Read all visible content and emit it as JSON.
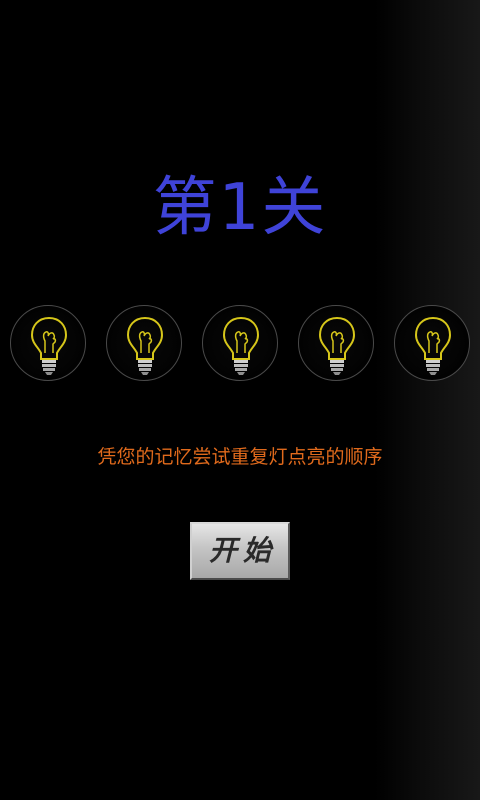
{
  "level": {
    "title": "第1关"
  },
  "bulbs": [
    {
      "state": "off",
      "glow_color": "#d6c61a"
    },
    {
      "state": "off",
      "glow_color": "#d6c61a"
    },
    {
      "state": "off",
      "glow_color": "#d6c61a"
    },
    {
      "state": "off",
      "glow_color": "#d6c61a"
    },
    {
      "state": "off",
      "glow_color": "#d6c61a"
    }
  ],
  "instruction": {
    "text": "凭您的记忆尝试重复灯点亮的顺序"
  },
  "start_button": {
    "label": "开始"
  },
  "colors": {
    "title": "#3f43d8",
    "instruction": "#e06a1c",
    "bulb_outline": "#d6c61a",
    "background": "#000000"
  }
}
